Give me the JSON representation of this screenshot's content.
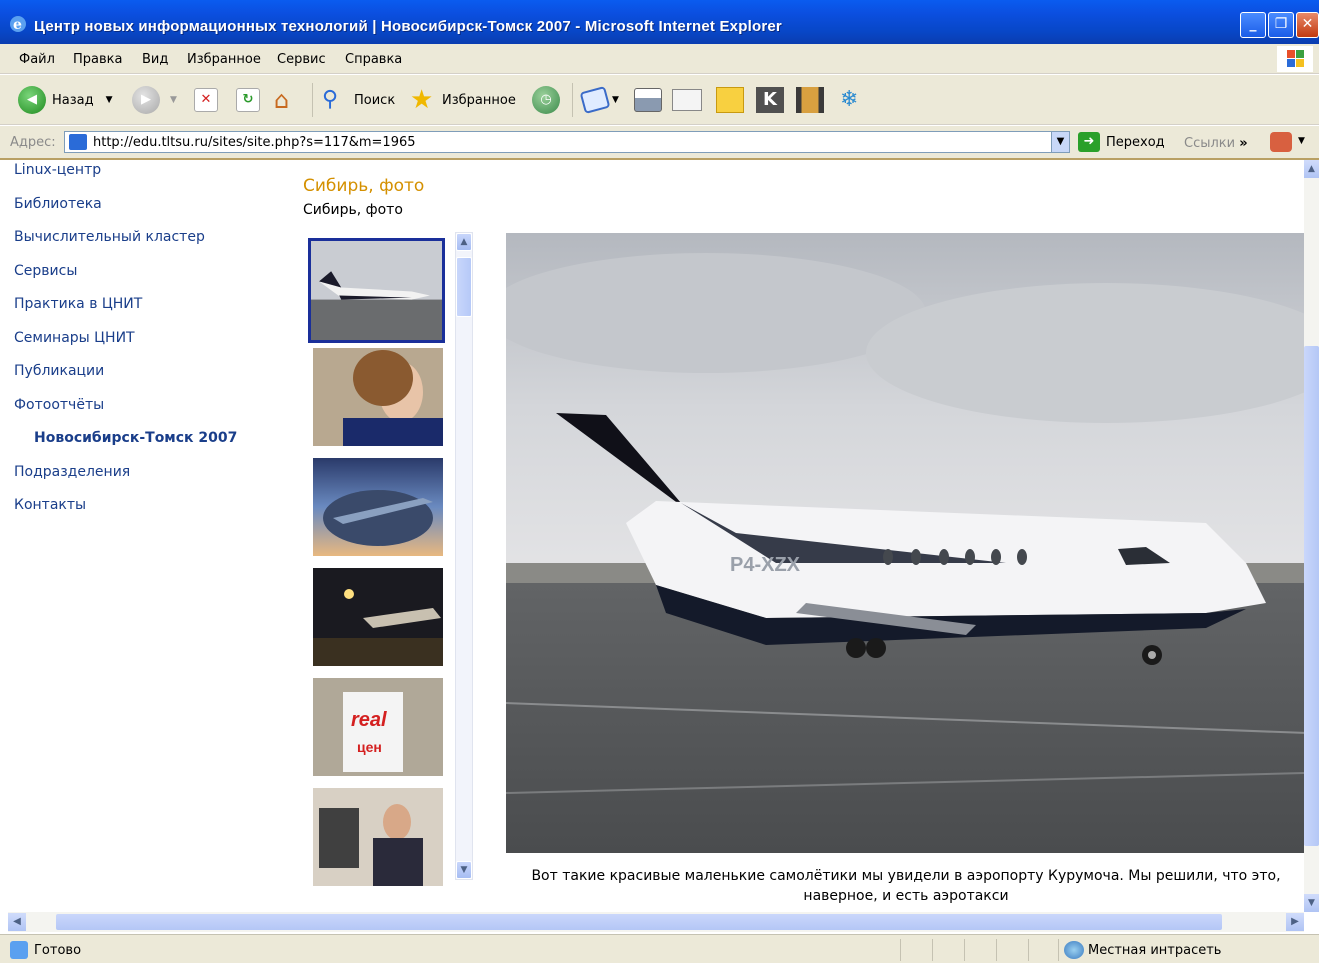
{
  "window": {
    "title": "Центр новых информационных технологий | Новосибирск-Томск 2007 - Microsoft Internet Explorer"
  },
  "menu": [
    "Файл",
    "Правка",
    "Вид",
    "Избранное",
    "Сервис",
    "Справка"
  ],
  "toolbar": {
    "back": "Назад",
    "search": "Поиск",
    "favorites": "Избранное"
  },
  "address": {
    "label": "Адрес:",
    "url": "http://edu.tltsu.ru/sites/site.php?s=117&m=1965",
    "go": "Переход",
    "links": "Ссылки"
  },
  "nav": {
    "items": [
      "Linux-центр",
      "Библиотека",
      "Вычислительный кластер",
      "Сервисы",
      "Практика в ЦНИТ",
      "Семинары ЦНИТ",
      "Публикации",
      "Фотоотчёты"
    ],
    "sub_active": "Новосибирск-Томск 2007",
    "items_after": [
      "Подразделения",
      "Контакты"
    ]
  },
  "gallery": {
    "heading": "Сибирь, фото",
    "subheading": "Сибирь, фото",
    "caption": "Вот такие красивые маленькие самолётики мы увидели в аэропорту Курумоча. Мы решили, что это, наверное, и есть аэротакси",
    "registration": "P4-XZX"
  },
  "status": {
    "left": "Готово",
    "zone": "Местная интрасеть"
  }
}
